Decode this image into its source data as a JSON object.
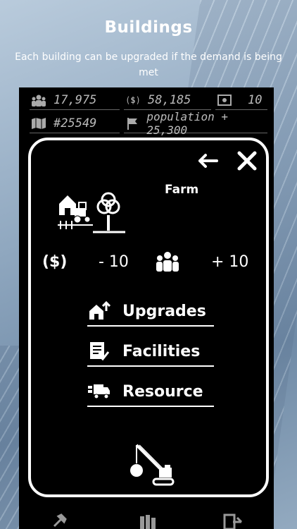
{
  "screen": {
    "title": "Buildings",
    "subtitle": "Each building can be upgraded if the demand is being met"
  },
  "stats": {
    "population_count": "17,975",
    "money": "58,185",
    "level": "10",
    "rank": "#25549",
    "goal": "population + 25,300"
  },
  "building": {
    "name": "Farm",
    "cost": "- 10",
    "population_gain": "+ 10"
  },
  "menu": {
    "upgrades": "Upgrades",
    "facilities": "Facilities",
    "resource": "Resource"
  },
  "icons": {
    "population": "people-icon",
    "money": "money-cycle-icon",
    "level": "certificate-icon",
    "rank": "map-icon",
    "goal": "flag-icon",
    "back": "arrow-left-icon",
    "close": "close-icon",
    "farm": "farm-icon",
    "demolish": "crane-wrecking-ball-icon"
  },
  "colors": {
    "panel": "#000000",
    "text": "#ffffff",
    "muted": "#bbbbbb"
  }
}
